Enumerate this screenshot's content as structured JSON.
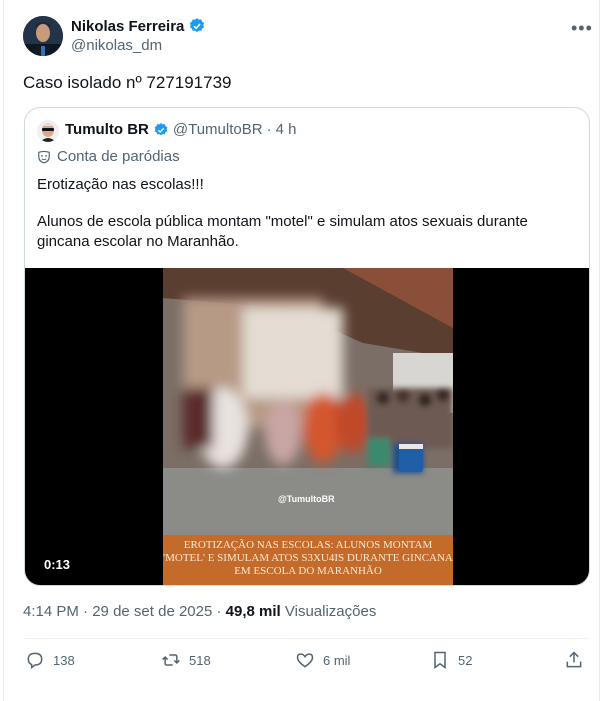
{
  "author": {
    "name": "Nikolas Ferreira",
    "handle": "@nikolas_dm",
    "verified_color": "#1d9bf0"
  },
  "more_icon": "more-icon",
  "tweet_text": "Caso isolado nº 727191739",
  "quote": {
    "name": "Tumulto BR",
    "handle": "@TumultoBR",
    "separator": "·",
    "time": "4 h",
    "parody_label": "Conta de paródias",
    "text_line1": "Erotização nas escolas!!!",
    "text_line2": "Alunos de escola pública montam \"motel\" e simulam atos sexuais durante gincana escolar no Maranhão.",
    "video": {
      "watermark": "@TumultoBR",
      "caption": "EROTIZAÇÃO NAS ESCOLAS: ALUNOS MONTAM 'MOTEL' E SIMULAM ATOS S3XU4IS DURANTE GINCANA EM ESCOLA DO MARANHÃO",
      "duration": "0:13"
    }
  },
  "meta": {
    "time": "4:14 PM",
    "separator": "·",
    "date": "29 de set de 2025",
    "separator2": "·",
    "views_count": "49,8 mil",
    "views_label": "Visualizações"
  },
  "actions": {
    "replies": "138",
    "retweets": "518",
    "likes": "6 mil",
    "bookmarks": "52"
  }
}
